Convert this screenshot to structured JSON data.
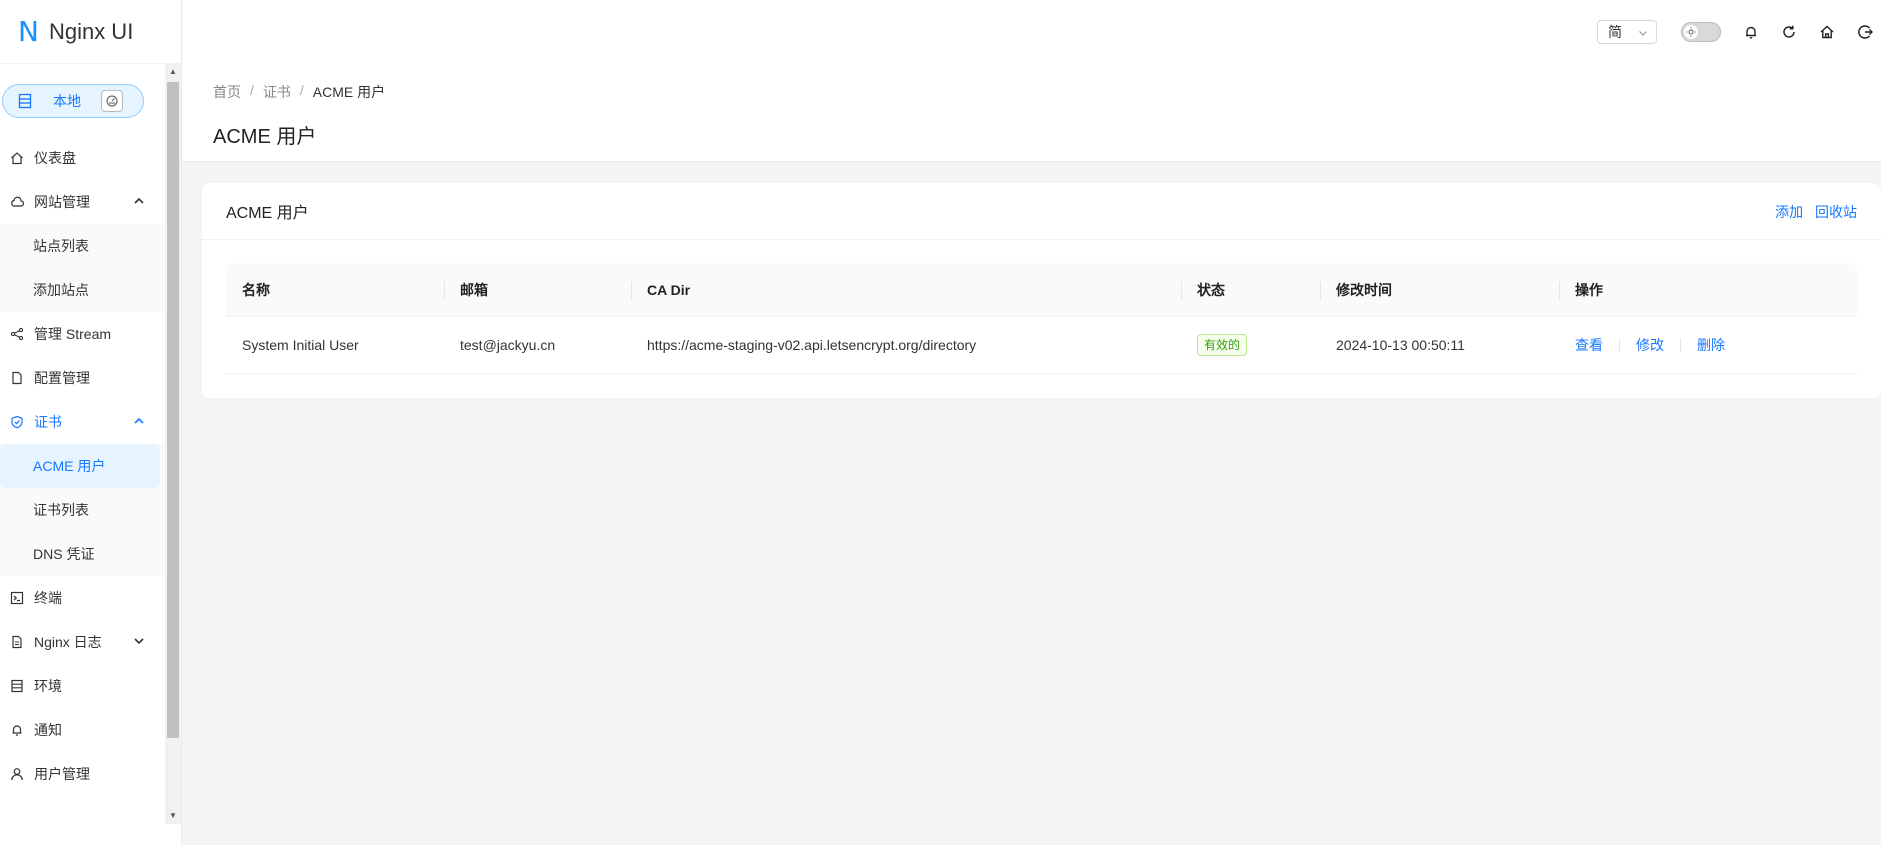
{
  "app": {
    "logo_mark": "N",
    "name": "Nginx UI"
  },
  "env": {
    "label": "本地"
  },
  "sidebar": {
    "items": [
      {
        "label": "仪表盘"
      },
      {
        "label": "网站管理"
      },
      {
        "label": "站点列表"
      },
      {
        "label": "添加站点"
      },
      {
        "label": "管理 Stream"
      },
      {
        "label": "配置管理"
      },
      {
        "label": "证书"
      },
      {
        "label": "ACME 用户"
      },
      {
        "label": "证书列表"
      },
      {
        "label": "DNS 凭证"
      },
      {
        "label": "终端"
      },
      {
        "label": "Nginx 日志"
      },
      {
        "label": "环境"
      },
      {
        "label": "通知"
      },
      {
        "label": "用户管理"
      }
    ]
  },
  "header": {
    "lang": "简"
  },
  "breadcrumb": [
    "首页",
    "证书",
    "ACME 用户"
  ],
  "page": {
    "title": "ACME 用户"
  },
  "card": {
    "title": "ACME 用户",
    "add_label": "添加",
    "trash_label": "回收站"
  },
  "table": {
    "columns": [
      "名称",
      "邮箱",
      "CA Dir",
      "状态",
      "修改时间",
      "操作"
    ],
    "rows": [
      {
        "name": "System Initial User",
        "email": "test@jackyu.cn",
        "ca_dir": "https://acme-staging-v02.api.letsencrypt.org/directory",
        "status": "有效的",
        "modified": "2024-10-13 00:50:11",
        "actions": [
          "查看",
          "修改",
          "删除"
        ]
      }
    ]
  },
  "colors": {
    "accent": "#1677ff",
    "status_ok": "#389e0d"
  }
}
